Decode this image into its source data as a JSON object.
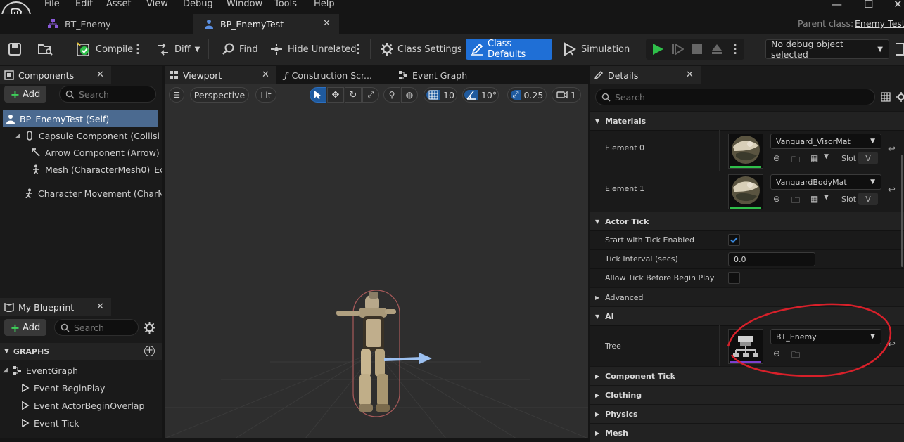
{
  "menu": [
    "File",
    "Edit",
    "Asset",
    "View",
    "Debug",
    "Window",
    "Tools",
    "Help"
  ],
  "tabs": [
    {
      "label": "BT_Enemy"
    },
    {
      "label": "BP_EnemyTest"
    }
  ],
  "parent_class": {
    "label": "Parent class:",
    "value": "Enemy Test"
  },
  "toolbar": {
    "compile": "Compile",
    "diff": "Diff",
    "find": "Find",
    "hide_unrelated": "Hide Unrelated",
    "class_settings": "Class Settings",
    "class_defaults": "Class Defaults",
    "simulation": "Simulation",
    "debug_object": "No debug object selected"
  },
  "components": {
    "title": "Components",
    "add": "Add",
    "search_placeholder": "Search",
    "items": [
      "BP_EnemyTest (Self)",
      "Capsule Component (CollisionCylinder)",
      "Arrow Component (Arrow)",
      "Mesh (CharacterMesh0)",
      "Character Movement (CharMoveComp)"
    ],
    "arrow_edit": "I",
    "mesh_edit": "Ec"
  },
  "my_blueprint": {
    "title": "My Blueprint",
    "add": "Add",
    "search_placeholder": "Search",
    "graphs_header": "GRAPHS",
    "event_graph": "EventGraph",
    "events": [
      "Event BeginPlay",
      "Event ActorBeginOverlap",
      "Event Tick"
    ]
  },
  "editor_tabs": {
    "viewport": "Viewport",
    "construction": "Construction Scr...",
    "event_graph": "Event Graph"
  },
  "viewport_bar": {
    "perspective": "Perspective",
    "lit": "Lit",
    "grid_snap": "10",
    "rot_snap": "10°",
    "scale_snap": "0.25",
    "camera_speed": "1"
  },
  "details": {
    "title": "Details",
    "search_placeholder": "Search",
    "categories": {
      "materials": "Materials",
      "actor_tick": "Actor Tick",
      "advanced": "Advanced",
      "ai": "AI",
      "component_tick": "Component Tick",
      "clothing": "Clothing",
      "physics": "Physics",
      "mesh": "Mesh"
    },
    "element0": {
      "label": "Element 0",
      "value": "Vanguard_VisorMat",
      "slot_label": "Slot",
      "slot_value": "V"
    },
    "element1": {
      "label": "Element 1",
      "value": "VanguardBodyMat",
      "slot_label": "Slot",
      "slot_value": "V"
    },
    "start_tick": {
      "label": "Start with Tick Enabled",
      "checked": true
    },
    "tick_interval": {
      "label": "Tick Interval (secs)",
      "value": "0.0"
    },
    "allow_tick": {
      "label": "Allow Tick Before Begin Play",
      "checked": false
    },
    "tree": {
      "label": "Tree",
      "value": "BT_Enemy"
    }
  },
  "colors": {
    "accent_blue": "#1f6fd6",
    "annotation_red": "#d8202a",
    "behavior_tree_purple": "#7b3fd0",
    "material_green": "#2fbf4a"
  }
}
